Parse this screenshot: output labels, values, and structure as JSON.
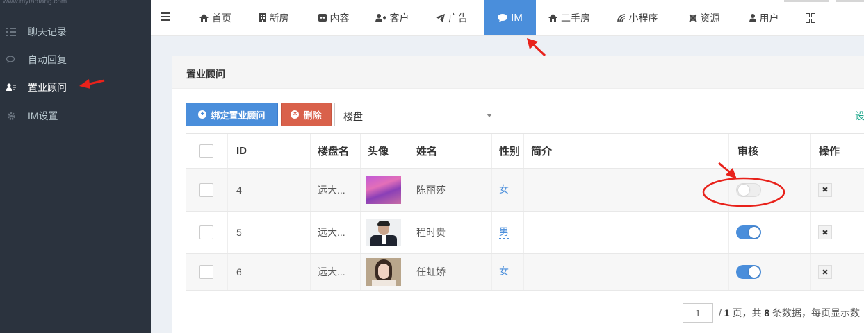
{
  "sidebar": {
    "watermark": "www.mytaofang.com",
    "items": [
      {
        "label": "聊天记录",
        "icon": "list-icon"
      },
      {
        "label": "自动回复",
        "icon": "comments-icon"
      },
      {
        "label": "置业顾问",
        "icon": "user-card-icon"
      },
      {
        "label": "IM设置",
        "icon": "gear-icon"
      }
    ]
  },
  "topnav": {
    "tabs": [
      {
        "label": "首页",
        "icon": "home-icon"
      },
      {
        "label": "新房",
        "icon": "building-icon"
      },
      {
        "label": "内容",
        "icon": "content-icon"
      },
      {
        "label": "客户",
        "icon": "user-plus-icon"
      },
      {
        "label": "广告",
        "icon": "paper-plane-icon"
      },
      {
        "label": "IM",
        "icon": "chat-bubble-icon"
      },
      {
        "label": "二手房",
        "icon": "house-icon"
      },
      {
        "label": "小程序",
        "icon": "wifi-icon"
      },
      {
        "label": "资源",
        "icon": "resource-icon"
      },
      {
        "label": "用户",
        "icon": "user-icon"
      }
    ],
    "active_tab": "IM"
  },
  "panel": {
    "title": "置业顾问",
    "bind_button": "绑定置业顾问",
    "delete_button": "删除",
    "select_value": "楼盘",
    "settings_link": "设"
  },
  "table": {
    "headers": {
      "id": "ID",
      "estate": "楼盘名",
      "avatar": "头像",
      "name": "姓名",
      "gender": "性别",
      "intro": "简介",
      "review": "审核",
      "ops": "操作"
    },
    "rows": [
      {
        "id": "4",
        "estate": "远大...",
        "name": "陈丽莎",
        "gender": "女",
        "intro": "",
        "approved": false
      },
      {
        "id": "5",
        "estate": "远大...",
        "name": "程时贵",
        "gender": "男",
        "intro": "",
        "approved": true
      },
      {
        "id": "6",
        "estate": "远大...",
        "name": "任虹娇",
        "gender": "女",
        "intro": "",
        "approved": true
      }
    ]
  },
  "pagination": {
    "current_page": "1",
    "pages_prefix": "/",
    "total_pages": "1",
    "pages_suffix": "页，共",
    "total_records": "8",
    "records_suffix": "条数据，每页显示数"
  },
  "colors": {
    "accent": "#4a8edb",
    "danger": "#d9614b",
    "sidebar": "#2b333e",
    "annotation": "#e8221b"
  }
}
